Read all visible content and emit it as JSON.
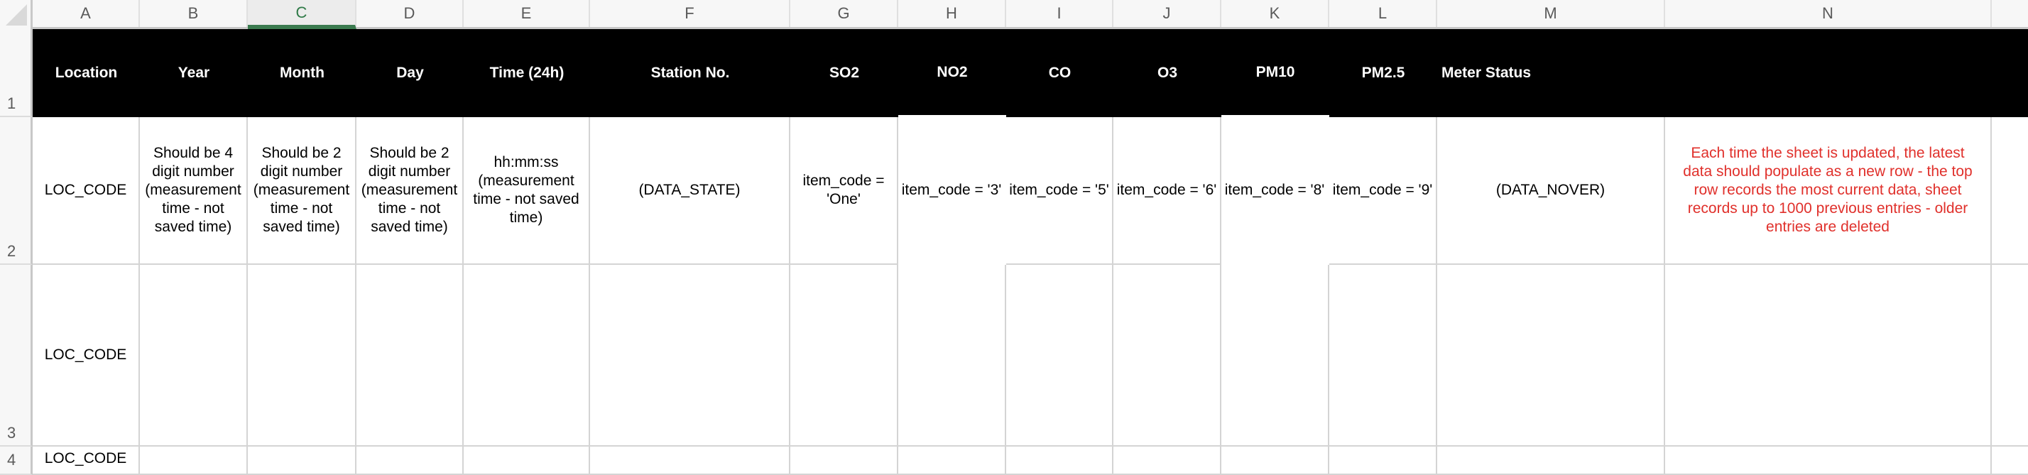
{
  "app": "Spreadsheet",
  "selected_column": "C",
  "column_headers": [
    "A",
    "B",
    "C",
    "D",
    "E",
    "F",
    "G",
    "H",
    "I",
    "J",
    "K",
    "L",
    "M",
    "N",
    ""
  ],
  "row_headers": [
    "1",
    "2",
    "3",
    "4"
  ],
  "header_row": {
    "location": "Location",
    "year": "Year",
    "month": "Month",
    "day": "Day",
    "time": "Time (24h)",
    "station_no": "Station No.",
    "so2": "SO2",
    "no2": "NO2",
    "co": "CO",
    "o3": "O3",
    "pm10": "PM10",
    "pm25": "PM2.5",
    "meter_status": "Meter Status"
  },
  "row2": {
    "location": "LOC_CODE",
    "year": "Should be 4 digit number (measurement time - not saved time)",
    "month": "Should be 2 digit number (measurement time - not saved time)",
    "day": "Should be 2 digit number (measurement time - not saved time)",
    "time": "hh:mm:ss (measurement time - not saved time)",
    "station_no": "(DATA_STATE)",
    "so2": "item_code = 'One'",
    "no2": "item_code = '3'",
    "co": "item_code = '5'",
    "o3": "item_code = '6'",
    "pm10": "item_code = '8'",
    "pm25": "item_code = '9'",
    "meter_status": "(DATA_NOVER)",
    "note": "Each time the sheet is updated, the latest data should populate as a new row - the top row records the most current data, sheet records up to 1000 previous entries - older entries are deleted"
  },
  "row3": {
    "location": "LOC_CODE"
  },
  "row4": {
    "location": "LOC_CODE"
  },
  "colors": {
    "header_bg": "#000000",
    "header_text": "#ffffff",
    "note_text": "#e0302b",
    "selected_col_accent": "#3b7b4f"
  }
}
